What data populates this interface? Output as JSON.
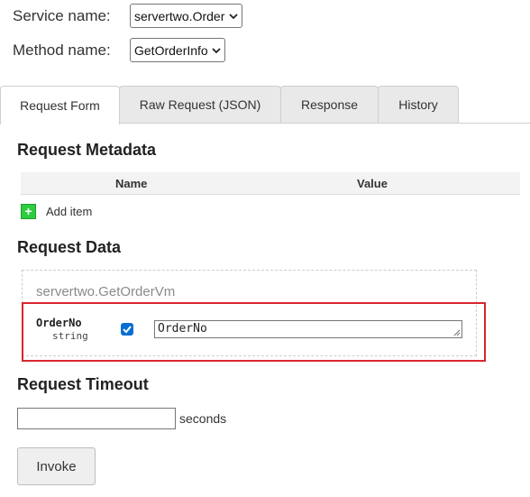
{
  "service": {
    "label": "Service name:",
    "selected": "servertwo.Order"
  },
  "method": {
    "label": "Method name:",
    "selected": "GetOrderInfo"
  },
  "tabs": [
    {
      "label": "Request Form",
      "active": true
    },
    {
      "label": "Raw Request (JSON)",
      "active": false
    },
    {
      "label": "Response",
      "active": false
    },
    {
      "label": "History",
      "active": false
    }
  ],
  "metadata": {
    "heading": "Request Metadata",
    "columns": {
      "name": "Name",
      "value": "Value"
    },
    "add_label": "Add item",
    "add_symbol": "+"
  },
  "request_data": {
    "heading": "Request Data",
    "message_type": "servertwo.GetOrderVm",
    "field": {
      "name": "OrderNo",
      "type": "string",
      "checked": true,
      "value": "OrderNo"
    }
  },
  "timeout": {
    "heading": "Request Timeout",
    "value": "",
    "unit": "seconds"
  },
  "invoke": {
    "label": "Invoke"
  },
  "colors": {
    "highlight": "#d9262c",
    "add_button": "#2ecc40",
    "checkbox": "#0a6ed1"
  }
}
